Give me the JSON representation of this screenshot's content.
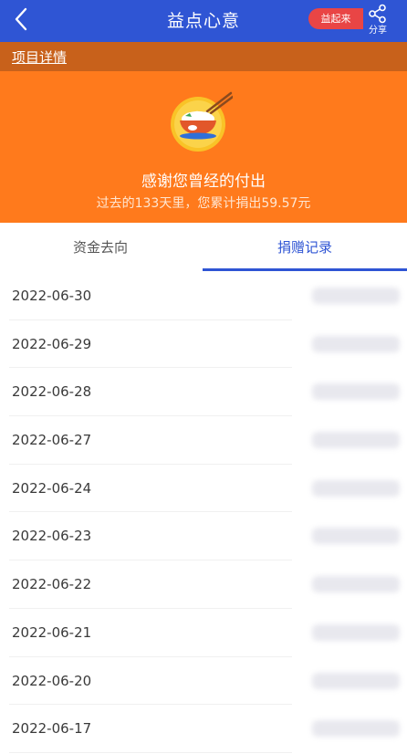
{
  "header": {
    "title": "益点心意",
    "yiqilai_label": "益起来",
    "share_label": "分享"
  },
  "detail": {
    "link_label": "项目详情"
  },
  "banner": {
    "thanks_text": "感谢您曾经的付出",
    "summary_text": "过去的133天里，您累计捐出59.57元"
  },
  "tabs": [
    {
      "label": "资金去向",
      "active": false
    },
    {
      "label": "捐赠记录",
      "active": true
    }
  ],
  "records": [
    {
      "date": "2022-06-30"
    },
    {
      "date": "2022-06-29"
    },
    {
      "date": "2022-06-28"
    },
    {
      "date": "2022-06-27"
    },
    {
      "date": "2022-06-24"
    },
    {
      "date": "2022-06-23"
    },
    {
      "date": "2022-06-22"
    },
    {
      "date": "2022-06-21"
    },
    {
      "date": "2022-06-20"
    },
    {
      "date": "2022-06-17"
    }
  ],
  "colors": {
    "header_bg": "#2f55d4",
    "strip_bg": "#c8611b",
    "banner_bg": "#ff7a1c",
    "badge_bg": "#e94545",
    "active_tab": "#2f55d4"
  }
}
